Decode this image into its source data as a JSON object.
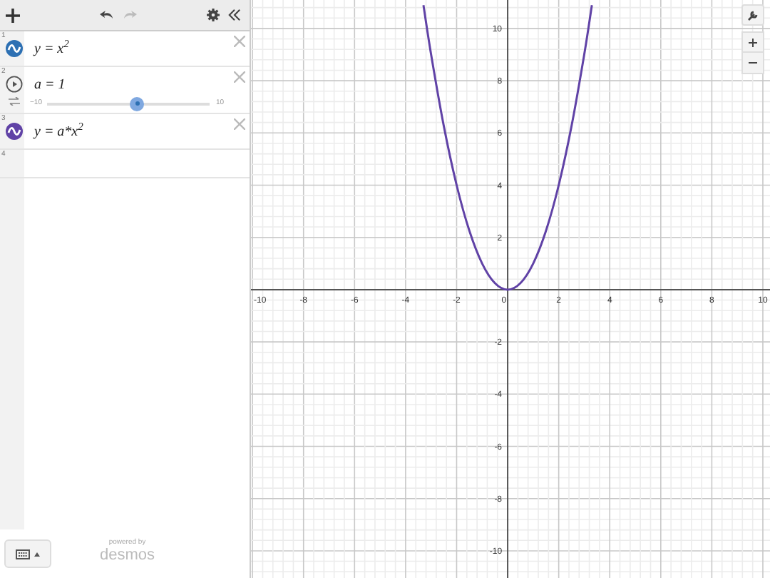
{
  "expressions": [
    {
      "kind": "expression",
      "number": "1",
      "text": "y = x$^{2}$",
      "color": "#2d70b3"
    },
    {
      "kind": "slider",
      "number": "2",
      "text": "a = 1",
      "min": "−10",
      "max": "10",
      "level": 0.55
    },
    {
      "kind": "expression",
      "number": "3",
      "text": "y = a*x$^{2}$",
      "color": "#6042a6"
    },
    {
      "kind": "empty",
      "number": "4"
    }
  ],
  "footer": {
    "powered_by": "powered by",
    "brand": "desmos"
  },
  "graph": {
    "chart_data": {
      "type": "line",
      "grid": true,
      "xlim": [
        -10.06,
        10.28
      ],
      "ylim": [
        -11.04,
        11.09
      ],
      "xticks": [
        -10,
        -8,
        -6,
        -4,
        -2,
        0,
        2,
        4,
        6,
        8,
        10
      ],
      "yticks": [
        -10,
        -8,
        -6,
        -4,
        -2,
        2,
        4,
        6,
        8,
        10
      ],
      "x": [
        -3.3,
        -3,
        -2.5,
        -2,
        -1.5,
        -1,
        -0.5,
        0,
        0.5,
        1,
        1.5,
        2,
        2.5,
        3,
        3.3
      ],
      "series": [
        {
          "color": "#6042a6",
          "values": [
            10.89,
            9,
            6.25,
            4,
            2.25,
            1,
            0.25,
            0,
            0.25,
            1,
            2.25,
            4,
            6.25,
            9,
            10.89
          ]
        }
      ]
    }
  }
}
